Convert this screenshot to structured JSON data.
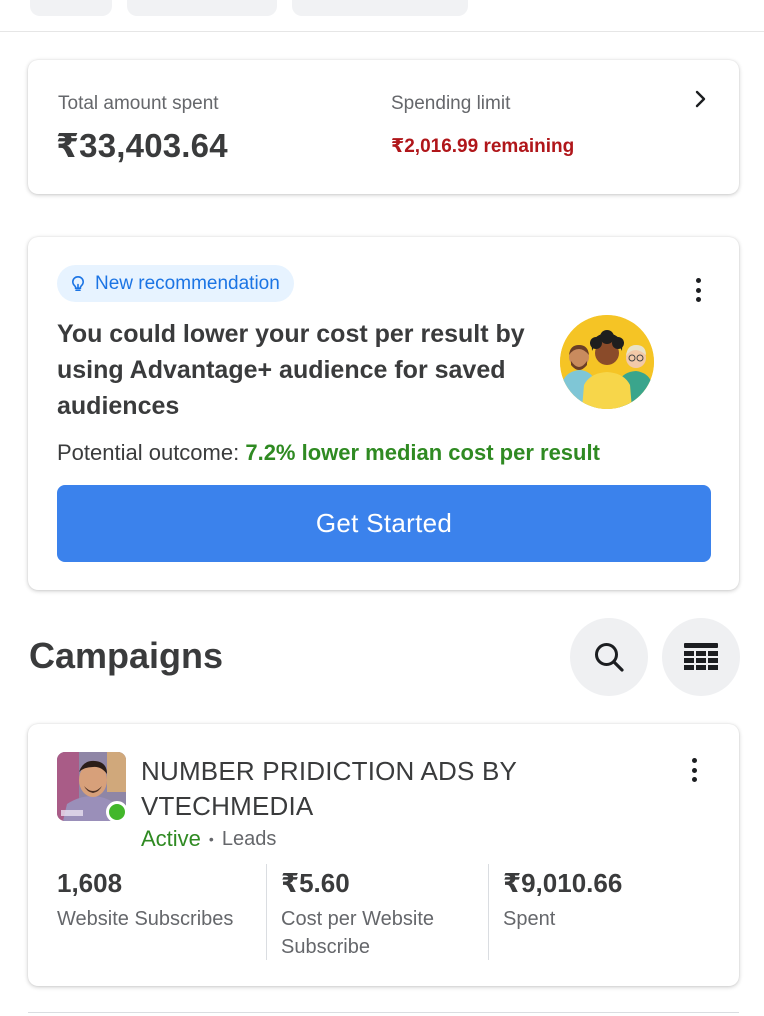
{
  "spend": {
    "total_label": "Total amount spent",
    "total_value": "₹33,403.64",
    "limit_label": "Spending limit",
    "limit_value": "₹2,016.99 remaining"
  },
  "recommendation": {
    "badge": "New recommendation",
    "title": "You could lower your cost per result by using Advantage+ audience for saved audiences",
    "outcome_label": "Potential outcome: ",
    "outcome_value": "7.2% lower median cost per result",
    "cta": "Get Started"
  },
  "campaigns": {
    "title": "Campaigns",
    "items": [
      {
        "name": "NUMBER PRIDICTION ADS BY VTECHMEDIA",
        "status": "Active",
        "separator": "•",
        "type": "Leads",
        "metrics": [
          {
            "value": "1,608",
            "label": "Website Subscribes"
          },
          {
            "value": "₹5.60",
            "label": "Cost per Website Subscribe"
          },
          {
            "value": "₹9,010.66",
            "label": "Spent"
          }
        ]
      }
    ]
  },
  "icons": {
    "chevron": "chevron-right-icon",
    "bulb": "lightbulb-icon",
    "more": "more-vertical-icon",
    "search": "search-icon",
    "table": "table-columns-icon"
  },
  "colors": {
    "accent": "#3b82ec",
    "negative": "#b0161a",
    "positive": "#2f8a22",
    "badge_bg": "#e7f3ff"
  }
}
